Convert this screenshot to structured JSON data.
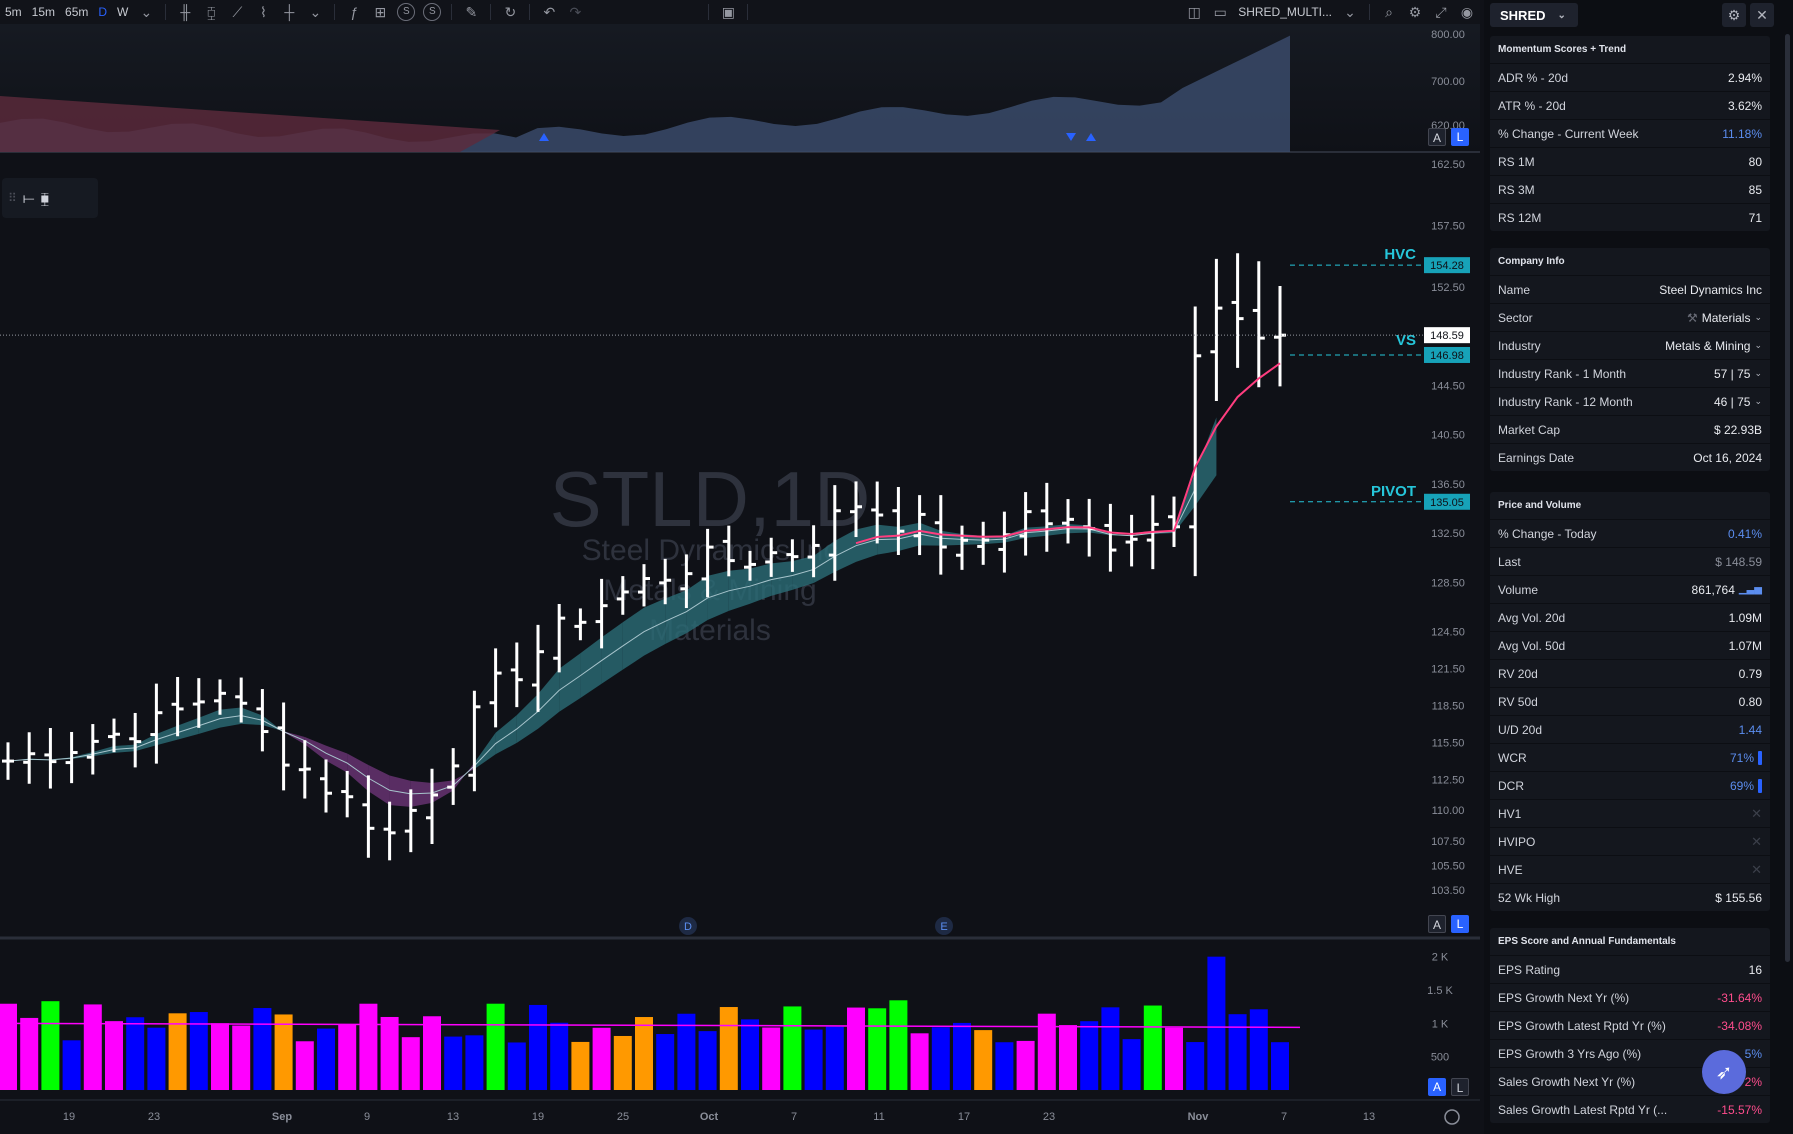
{
  "toolbar": {
    "intervals": [
      "5m",
      "15m",
      "65m",
      "D",
      "W"
    ],
    "active_interval": "D",
    "study_buttons": [
      "S",
      "S"
    ],
    "layout_name": "SHRED_MULTI..."
  },
  "chart": {
    "watermark": {
      "symbol": "STLD,1D",
      "name": "Steel Dynamics Inc",
      "industry": "Metals & Mining",
      "sector": "Materials"
    },
    "indicator_scale": [
      "800.00",
      "700.00",
      "620.00"
    ],
    "price_scale": [
      "162.50",
      "157.50",
      "152.50",
      "148.59",
      "144.50",
      "140.50",
      "136.50",
      "132.50",
      "128.50",
      "124.50",
      "121.50",
      "118.50",
      "115.50",
      "112.50",
      "110.00",
      "107.50",
      "105.50",
      "103.50"
    ],
    "volume_scale": [
      "2 K",
      "1.5 K",
      "1 K",
      "500"
    ],
    "time_labels": [
      "19",
      "23",
      "Sep",
      "9",
      "13",
      "19",
      "25",
      "Oct",
      "7",
      "11",
      "17",
      "23",
      "Nov",
      "7",
      "13"
    ],
    "levels": [
      {
        "name": "HVC",
        "price": "154.28",
        "color": "#26c6da"
      },
      {
        "name": "VS",
        "price": "146.98",
        "color": "#26c6da"
      },
      {
        "name": "PIVOT",
        "price": "135.05",
        "color": "#26c6da"
      }
    ],
    "last_price": "148.59",
    "event_markers": [
      "D",
      "E"
    ],
    "axis_buttons": {
      "a": "A",
      "l": "L"
    },
    "colors": {
      "up_volume": "#0000ff",
      "high_volume": "#ff00ff",
      "pocket": "#00ff00",
      "low_volume": "#ff9900",
      "ribbon_up": "#2a6d77",
      "ribbon_down": "#6b3577",
      "ma": "#ff3d7f"
    },
    "chart_data": {
      "type": "ohlc",
      "title": "STLD,1D",
      "y_unit": "USD",
      "ylim": [
        103.5,
        162.5
      ],
      "x_range": [
        "Aug 15",
        "Nov 8"
      ],
      "price_levels": {
        "HVC": 154.28,
        "last": 148.59,
        "VS": 146.98,
        "PIVOT": 135.05
      }
    }
  },
  "panel": {
    "symbol": "SHRED",
    "sections": [
      {
        "title": "Momentum Scores + Trend",
        "rows": [
          {
            "label": "ADR % - 20d",
            "value": "2.94%"
          },
          {
            "label": "ATR % - 20d",
            "value": "3.62%"
          },
          {
            "label": "% Change - Current Week",
            "value": "11.18%",
            "style": "blue"
          },
          {
            "label": "RS 1M",
            "value": "80"
          },
          {
            "label": "RS 3M",
            "value": "85"
          },
          {
            "label": "RS 12M",
            "value": "71"
          }
        ]
      },
      {
        "title": "Company Info",
        "rows": [
          {
            "label": "Name",
            "value": "Steel Dynamics Inc"
          },
          {
            "label": "Sector",
            "value": "Materials",
            "dropdown": true,
            "icon": "sector-icon"
          },
          {
            "label": "Industry",
            "value": "Metals & Mining",
            "dropdown": true
          },
          {
            "label": "Industry Rank - 1 Month",
            "value": "57 | 75",
            "dropdown": true
          },
          {
            "label": "Industry Rank - 12 Month",
            "value": "46 | 75",
            "dropdown": true
          },
          {
            "label": "Market Cap",
            "value": "$ 22.93B"
          },
          {
            "label": "Earnings Date",
            "value": "Oct 16, 2024"
          }
        ]
      },
      {
        "title": "Price and Volume",
        "rows": [
          {
            "label": "% Change - Today",
            "value": "0.41%",
            "style": "blue"
          },
          {
            "label": "Last",
            "value": "$ 148.59",
            "style": "grey"
          },
          {
            "label": "Volume",
            "value": "861,764",
            "icon": "volume-bars-icon"
          },
          {
            "label": "Avg Vol. 20d",
            "value": "1.09M"
          },
          {
            "label": "Avg Vol. 50d",
            "value": "1.07M"
          },
          {
            "label": "RV 20d",
            "value": "0.79"
          },
          {
            "label": "RV 50d",
            "value": "0.80"
          },
          {
            "label": "U/D 20d",
            "value": "1.44",
            "style": "blue"
          },
          {
            "label": "WCR",
            "value": "71%",
            "style": "blue",
            "bar": true
          },
          {
            "label": "DCR",
            "value": "69%",
            "style": "blue",
            "bar": true
          },
          {
            "label": "HV1",
            "value": "✕",
            "style": "x"
          },
          {
            "label": "HVIPO",
            "value": "✕",
            "style": "x"
          },
          {
            "label": "HVE",
            "value": "✕",
            "style": "x"
          },
          {
            "label": "52 Wk High",
            "value": "$ 155.56"
          }
        ]
      },
      {
        "title": "EPS Score and Annual Fundamentals",
        "rows": [
          {
            "label": "EPS Rating",
            "value": "16"
          },
          {
            "label": "EPS Growth Next Yr (%)",
            "value": "-31.64%",
            "style": "pink"
          },
          {
            "label": "EPS Growth Latest Rptd Yr (%)",
            "value": "-34.08%",
            "style": "pink"
          },
          {
            "label": "EPS Growth 3 Yrs Ago (%)",
            "value": "5%",
            "style": "blue"
          },
          {
            "label": "Sales Growth Next Yr (%)",
            "value": "2%",
            "style": "pink"
          },
          {
            "label": "Sales Growth Latest Rptd Yr (...",
            "value": "-15.57%",
            "style": "pink"
          }
        ]
      }
    ]
  }
}
